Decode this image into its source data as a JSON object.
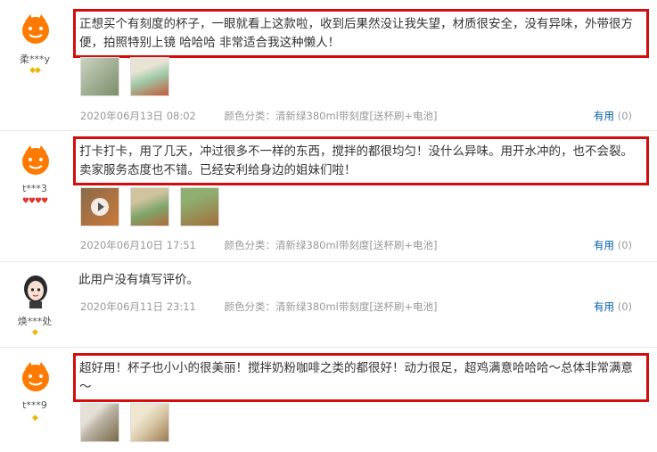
{
  "reviews": [
    {
      "username": "柔***y",
      "level": "◆◆",
      "text": "正想买个有刻度的杯子，一眼就看上这款啦，收到后果然没让我失望，材质很安全，没有异味，外带很方便，拍照特别上镜 哈哈哈 非常适合我这种懒人！",
      "date": "2020年06月13日 08:02",
      "spec_label": "颜色分类：",
      "spec_value": "清新绿380ml带刻度[送杯刷+电池]",
      "useful_label": "有用",
      "useful_count": "(0)",
      "thumbs": [
        {
          "icon": "photo-thumbnail",
          "colors": [
            "#c9d3c0",
            "#7b8d6a"
          ]
        },
        {
          "icon": "photo-thumbnail",
          "colors": [
            "#9ec9a8",
            "#c55a3a"
          ]
        }
      ]
    },
    {
      "username": "t***3",
      "level": "♥♥♥♥",
      "text": "打卡打卡，用了几天，冲过很多不一样的东西，搅拌的都很均匀！没什么异味。用开水冲的，也不会裂。卖家服务态度也不错。已经安利给身边的姐妹们啦！",
      "date": "2020年06月10日 17:51",
      "spec_label": "颜色分类：",
      "spec_value": "清新绿380ml带刻度[送杯刷+电池]",
      "useful_label": "有用",
      "useful_count": "(0)",
      "thumbs": [
        {
          "icon": "video-thumbnail",
          "colors": [
            "#8a6a4a",
            "#c97a3a"
          ]
        },
        {
          "icon": "photo-thumbnail",
          "colors": [
            "#cfc3a0",
            "#7ea56a"
          ]
        },
        {
          "icon": "photo-thumbnail",
          "colors": [
            "#8fae6f",
            "#a26f3c"
          ]
        }
      ]
    },
    {
      "username": "焕***处",
      "level": "◆",
      "text": "此用户没有填写评价。",
      "date": "2020年06月11日 23:11",
      "spec_label": "颜色分类：",
      "spec_value": "清新绿380ml带刻度[送杯刷+电池]",
      "useful_label": "有用",
      "useful_count": "(0)",
      "thumbs": []
    },
    {
      "username": "t***9",
      "level": "◆",
      "text": "超好用！杯子也小小的很美丽！搅拌奶粉咖啡之类的都很好！动力很足，超鸡满意哈哈哈～总体非常满意～",
      "date": "",
      "spec_label": "",
      "spec_value": "",
      "useful_label": "",
      "useful_count": "",
      "thumbs": [
        {
          "icon": "photo-thumbnail",
          "colors": [
            "#b8b0a0",
            "#7a6a4a"
          ]
        },
        {
          "icon": "photo-thumbnail",
          "colors": [
            "#d8c8a8",
            "#9c7a50"
          ]
        }
      ]
    }
  ]
}
